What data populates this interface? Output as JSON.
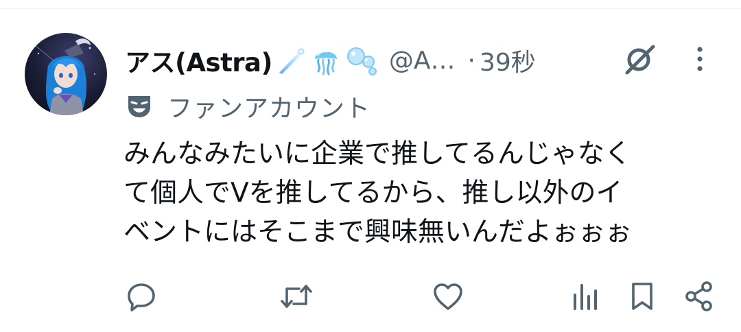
{
  "tweet": {
    "display_name": "アス(Astra)",
    "handle": "@A…",
    "separator": "·",
    "time": "39秒",
    "label": "ファンアカウント",
    "text_lines": [
      "みんなみたいに企業で推してるんじゃなく",
      "て個人でVを推してるから、推し以外のイ",
      "ベントにはそこまで興味無いんだよぉぉぉ"
    ]
  },
  "icons": {
    "name_emojis": [
      "comet-emoji",
      "jellyfish-emoji",
      "bubbles-emoji"
    ],
    "label_icon": "theater-mask-icon",
    "header_actions": [
      "grok-icon",
      "more-icon"
    ],
    "actions": [
      "reply-icon",
      "retweet-icon",
      "like-icon",
      "views-icon",
      "bookmark-icon",
      "share-icon"
    ]
  },
  "colors": {
    "text_primary": "#0f1419",
    "text_secondary": "#536471",
    "icon": "#536471",
    "divider": "#eff3f4"
  }
}
